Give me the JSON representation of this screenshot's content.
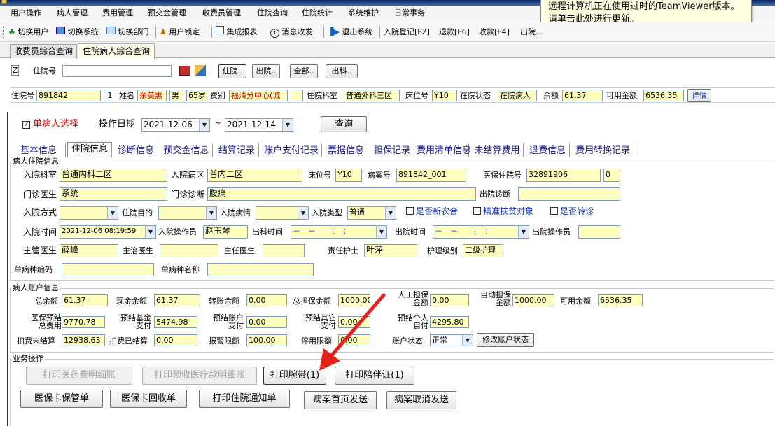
{
  "window": {
    "title": "■■■■■■■■ ■■■■■■■ ■■■■■ ■■■■■"
  },
  "teamviewer_notice": "远程计算机正在使用过时的TeamViewer版本。请单击此处进行更新。",
  "menubar": [
    "用户操作",
    "病人管理",
    "费用管理",
    "预交金管理",
    "收费员管理",
    "住院查询",
    "住院统计",
    "系统维护",
    "日常事务"
  ],
  "toolbar": {
    "switch_user": "切换用户",
    "switch_system": "切换系统",
    "switch_dept": "切换部门",
    "user_lock": "用户锁定",
    "integrated_report": "集成报表",
    "message": "消息收发",
    "exit_system": "退出系统",
    "admission_reg": "入院登记[F2]",
    "refund": "退款[F6]",
    "charge": "收款[F4]",
    "more": "出院..."
  },
  "doc_tabs": [
    "收费员综合查询",
    "住院病人综合查询"
  ],
  "search": {
    "z_label": "Z",
    "inpatient_no_label": "住院号",
    "inpatient_no_value": "",
    "filter_in": "住院..",
    "filter_out": "出院..",
    "filter_all": "全部..",
    "filter_dept_out": "出科.."
  },
  "patient_bar": {
    "inpatient_no_label": "住院号",
    "inpatient_no": "891842",
    "times": "1",
    "name_label": "姓名",
    "name": "余美惠",
    "sex": "男",
    "age": "65岁",
    "fee_type_label": "费别",
    "fee_type": "福清分中心(城",
    "dept_label": "住院科室",
    "dept": "普通外科三区",
    "bed_label": "床位号",
    "bed": "Y10",
    "status_label": "在院状态",
    "status": "在院病人",
    "balance_label": "余额",
    "balance": "61.37",
    "available_label": "可用金额",
    "available": "6536.35",
    "detail": "详情"
  },
  "query": {
    "single_patient": "单病人选择",
    "date_label": "操作日期",
    "date_from": "2021-12-06",
    "tilde": "~",
    "date_to": "2021-12-14",
    "query_button": "查询"
  },
  "info_tabs": [
    "基本信息",
    "住院信息",
    "诊断信息",
    "预交金信息",
    "结算记录",
    "账户支付记录",
    "票据信息",
    "担保记录",
    "费用清单信息",
    "未结算费用",
    "退费信息",
    "费用转换记录"
  ],
  "admission": {
    "group_title": "病人住院信息",
    "dept_label": "入院科室",
    "dept": "普通内科二区",
    "ward_label": "入院病区",
    "ward": "普内二区",
    "bed_label": "床位号",
    "bed": "Y10",
    "case_no_label": "病案号",
    "case_no": "891842_001",
    "insurance_no_label": "医保住院号",
    "insurance_no": "32891906",
    "insurance_extra": "0",
    "clinic_doctor_label": "门诊医生",
    "clinic_doctor": "系统",
    "clinic_diag_label": "门诊诊断",
    "clinic_diag": "腹痛",
    "discharge_diag_label": "出院诊断",
    "discharge_diag": "",
    "admit_mode_label": "入院方式",
    "admit_mode": "",
    "purpose_label": "住院目的",
    "purpose": "",
    "condition_label": "入院病情",
    "condition": "",
    "admit_type_label": "入院类型",
    "admit_type": "普通",
    "chk_ncms": "是否新农合",
    "chk_poverty": "精准扶贫对象",
    "chk_transfer": "是否转诊",
    "admit_time_label": "入院时间",
    "admit_time": "2021-12-06 08:19:59",
    "admit_operator_label": "入院操作员",
    "admit_operator": "赵玉琴",
    "dept_out_time_label": "出科时间",
    "dept_out_time": "－　－　　：　：",
    "discharge_time_label": "出院时间",
    "discharge_time": "－　－　　：　：",
    "discharge_operator_label": "出院操作员",
    "discharge_operator": "",
    "chief_doctor_label": "主管医生",
    "chief_doctor": "薛峰",
    "attending_label": "主治医生",
    "attending": "",
    "director_label": "主任医生",
    "director": "",
    "nurse_label": "责任护士",
    "nurse": "叶萍",
    "care_level_label": "护理级别",
    "care_level": "二级护理",
    "disease_code_label": "单病种编码",
    "disease_code": "",
    "disease_name_label": "单病种名称",
    "disease_name": ""
  },
  "account": {
    "group_title": "病人账户信息",
    "total_balance_label": "总余额",
    "total_balance": "61.37",
    "cash_balance_label": "现金余额",
    "cash_balance": "61.37",
    "transfer_balance_label": "转账余额",
    "transfer_balance": "0.00",
    "total_guarantee_label": "总担保金额",
    "total_guarantee": "1000.00",
    "manual_guarantee_label": "人工担保金额",
    "manual_guarantee": "0.00",
    "auto_guarantee_label": "自动担保金额",
    "auto_guarantee": "1000.00",
    "available_label": "可用余额",
    "available": "6536.35",
    "ins_total_label": "医保预结总费用",
    "ins_total": "9770.78",
    "fund_pay_label": "预结基金支付",
    "fund_pay": "5474.98",
    "account_pay_label": "预结账户支付",
    "account_pay": "0.00",
    "other_pay_label": "预结其它支付",
    "other_pay": "0.00",
    "self_pay_label": "预结个人自付",
    "self_pay": "4295.80",
    "unsettled_label": "扣费未结算",
    "unsettled": "12938.63",
    "settled_label": "扣费已结算",
    "settled": "0.00",
    "alarm_label": "报警限额",
    "alarm": "100.00",
    "stop_label": "停用限额",
    "stop": "0.00",
    "state_label": "账户状态",
    "state": "正常",
    "modify_state": "修改账户状态"
  },
  "ops": {
    "group_title": "业务操作",
    "print_drug_detail": "打印医药费明细账",
    "print_prepaid_detail": "打印预收医疗款明细账",
    "print_wristband": "打印腕带(1)",
    "print_escort": "打印陪伴证(1)",
    "ins_card_keep": "医保卡保管单",
    "ins_card_return": "医保卡回收单",
    "print_admission_notice": "打印住院通知单",
    "send_case_home": "病案首页发送",
    "cancel_case_send": "病案取消发送"
  },
  "colors": {
    "title_bar": "#0a246a",
    "accent_blue": "#1030c0",
    "field_yellow": "#ffffc0",
    "red_text": "#d00000",
    "annotation_red": "#e8201a"
  }
}
